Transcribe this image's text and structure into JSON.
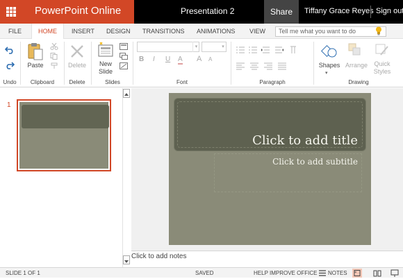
{
  "titlebar": {
    "app_name": "PowerPoint Online",
    "document_name": "Presentation 2",
    "share_label": "Share",
    "user_name": "Tiffany Grace Reyes",
    "signout_label": "Sign out"
  },
  "tabs": [
    "FILE",
    "HOME",
    "INSERT",
    "DESIGN",
    "TRANSITIONS",
    "ANIMATIONS",
    "VIEW"
  ],
  "active_tab": "HOME",
  "tell_me": {
    "placeholder": "Tell me what you want to do"
  },
  "ribbon": {
    "groups": {
      "undo": "Undo",
      "clipboard": "Clipboard",
      "delete": "Delete",
      "slides": "Slides",
      "font": "Font",
      "paragraph": "Paragraph",
      "drawing": "Drawing"
    },
    "buttons": {
      "paste": "Paste",
      "delete": "Delete",
      "new_slide_line1": "New",
      "new_slide_line2": "Slide",
      "shapes": "Shapes",
      "arrange": "Arrange",
      "quick_styles_line1": "Quick",
      "quick_styles_line2": "Styles"
    },
    "font_buttons": {
      "bold": "B",
      "italic": "I",
      "underline": "U",
      "font_color": "A",
      "grow": "A",
      "shrink": "A"
    }
  },
  "slides_pane": {
    "slides": [
      {
        "number": "1"
      }
    ]
  },
  "slide": {
    "title_placeholder": "Click to add title",
    "subtitle_placeholder": "Click to add subtitle"
  },
  "notes": {
    "placeholder": "Click to add notes"
  },
  "statusbar": {
    "slide_counter": "SLIDE 1 OF 1",
    "save_state": "SAVED",
    "help_improve": "HELP IMPROVE OFFICE",
    "notes_label": "NOTES"
  },
  "colors": {
    "brand": "#d24726",
    "slide_bg": "#8a8b78",
    "title_band": "#5e6150"
  }
}
